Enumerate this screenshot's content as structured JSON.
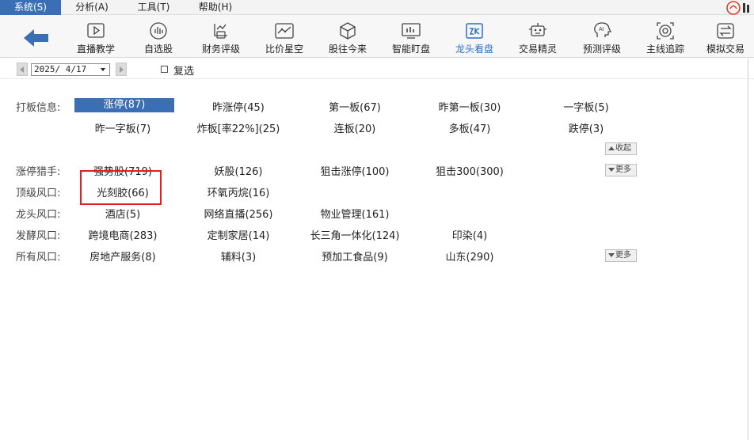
{
  "menu": {
    "items": [
      {
        "label": "系统(S)"
      },
      {
        "label": "分析(A)"
      },
      {
        "label": "工具(T)"
      },
      {
        "label": "帮助(H)"
      }
    ]
  },
  "toolbar": {
    "buttons": [
      {
        "label": "直播教学",
        "icon": "play-icon"
      },
      {
        "label": "自选股",
        "icon": "bars-icon"
      },
      {
        "label": "财务评级",
        "icon": "finance-icon"
      },
      {
        "label": "比价星空",
        "icon": "line-chart-icon"
      },
      {
        "label": "股往今来",
        "icon": "cube-icon"
      },
      {
        "label": "智能盯盘",
        "icon": "monitor-icon"
      },
      {
        "label": "龙头看盘",
        "icon": "dragon-icon"
      },
      {
        "label": "交易精灵",
        "icon": "robot-icon"
      },
      {
        "label": "预测评级",
        "icon": "ai-head-icon"
      },
      {
        "label": "主线追踪",
        "icon": "target-icon"
      },
      {
        "label": "模拟交易",
        "icon": "exchange-icon"
      }
    ],
    "active_index": 6,
    "accent_color": "#2d6fc9"
  },
  "date_row": {
    "date_value": "2025/ 4/17",
    "checkbox_label": "复选",
    "checkbox_checked": false
  },
  "sections": {
    "board_info": {
      "label": "打板信息:",
      "row1": [
        "涨停(87)",
        "昨涨停(45)",
        "第一板(67)",
        "昨第一板(30)",
        "一字板(5)"
      ],
      "row2": [
        "昨一字板(7)",
        "炸板[率22%](25)",
        "连板(20)",
        "多板(47)",
        "跌停(3)"
      ],
      "collapse_label": "收起"
    },
    "hunter": {
      "label": "涨停猎手:",
      "items": [
        "强势股(719)",
        "妖股(126)",
        "狙击涨停(100)",
        "狙击300(300)"
      ],
      "more_label": "更多"
    },
    "top": {
      "label": "顶级风口:",
      "items": [
        "光刻胶(66)",
        "环氧丙烷(16)"
      ]
    },
    "leader": {
      "label": "龙头风口:",
      "items": [
        "酒店(5)",
        "网络直播(256)",
        "物业管理(161)"
      ]
    },
    "ferment": {
      "label": "发酵风口:",
      "items": [
        "跨境电商(283)",
        "定制家居(14)",
        "长三角一体化(124)",
        "印染(4)"
      ]
    },
    "all": {
      "label": "所有风口:",
      "items": [
        "房地产服务(8)",
        "辅料(3)",
        "预加工食品(9)",
        "山东(290)"
      ],
      "more_label": "更多"
    }
  },
  "colors": {
    "selected_bg": "#3a6fb6",
    "highlight_border": "#e02020"
  }
}
